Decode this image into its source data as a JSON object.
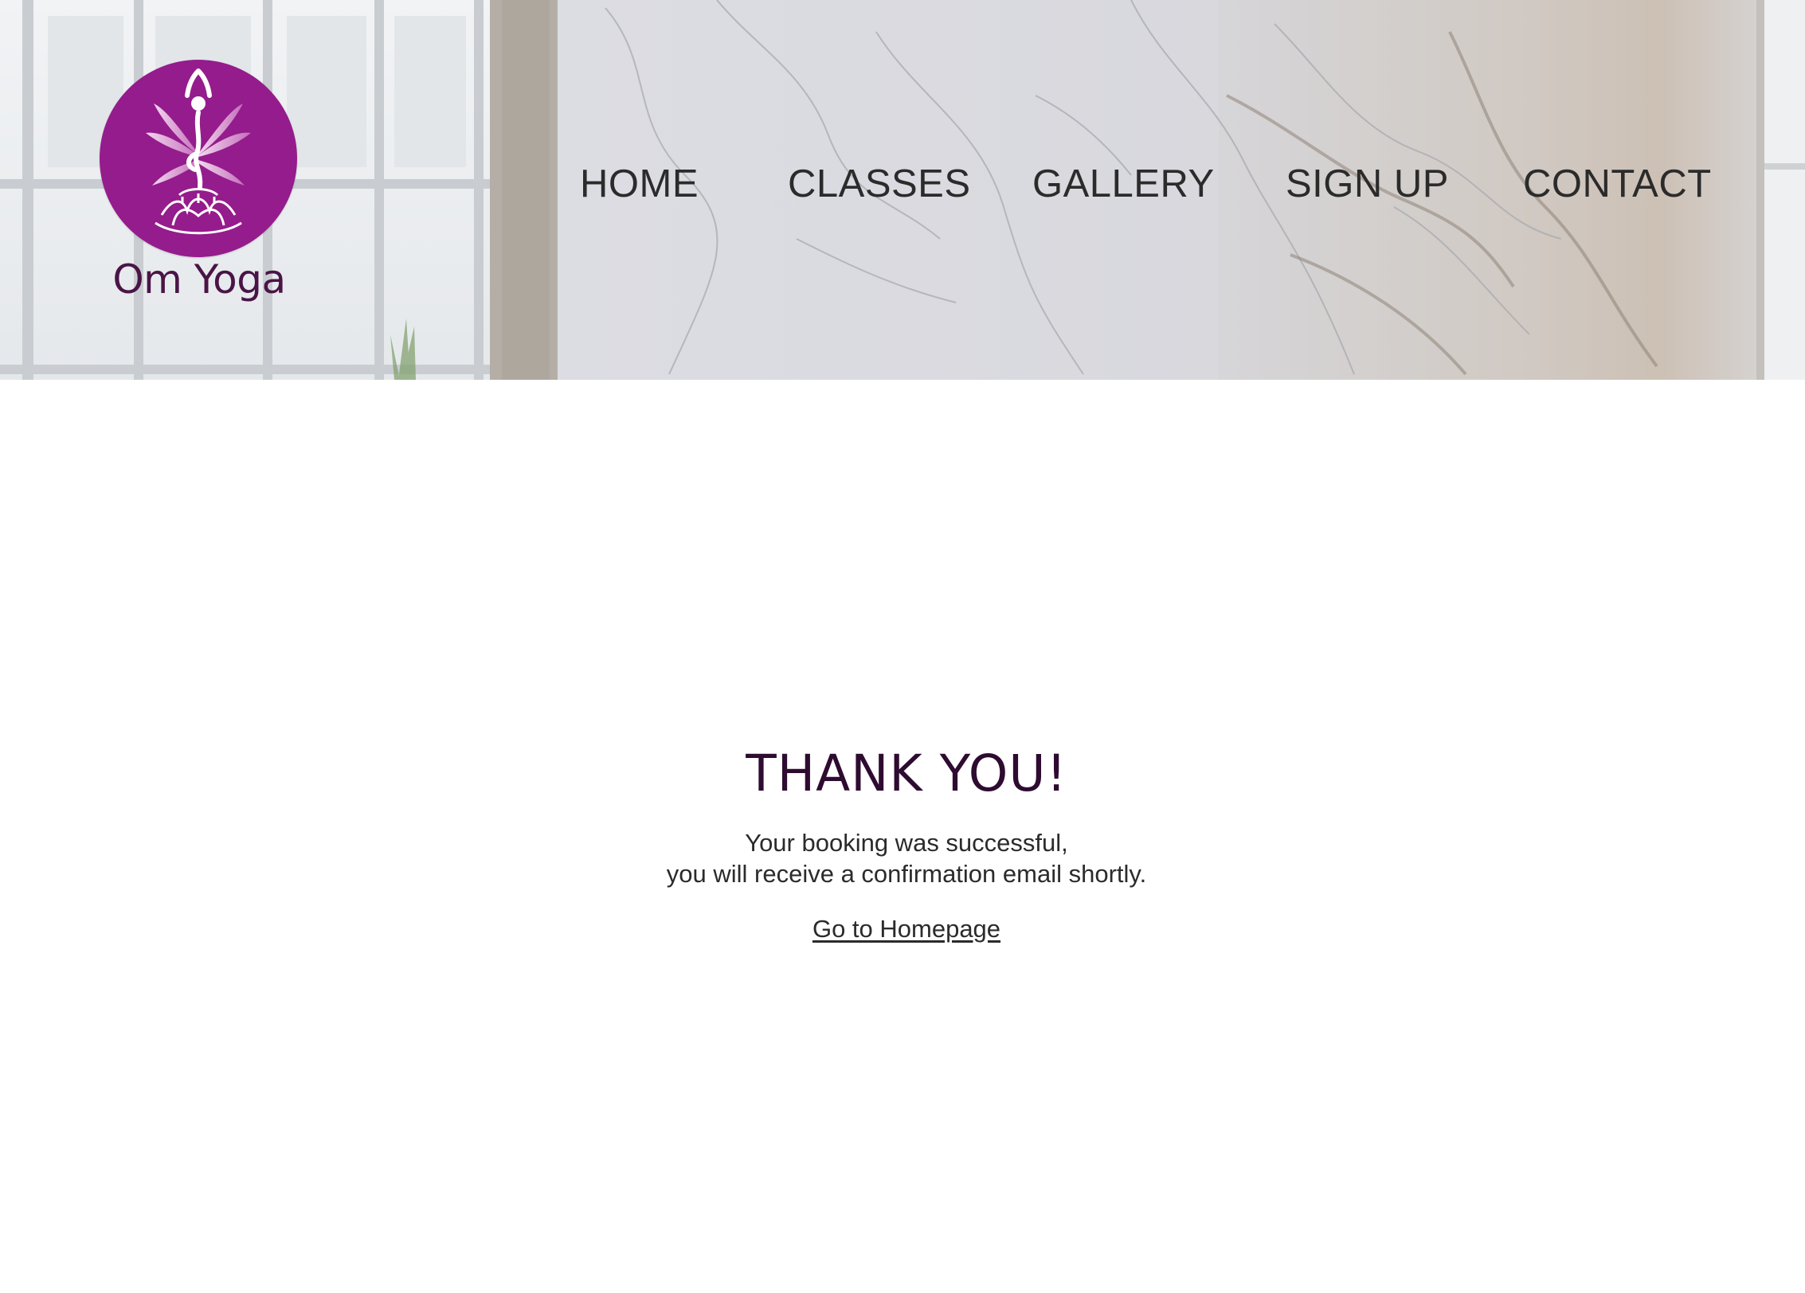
{
  "brand": {
    "name": "Om Yoga",
    "logo_icon": "yoga-tree-pose-lotus-icon",
    "logo_color": "#951c8c",
    "name_color": "#4a1446"
  },
  "nav": {
    "items": [
      {
        "label": "HOME"
      },
      {
        "label": "CLASSES"
      },
      {
        "label": "GALLERY"
      },
      {
        "label": "SIGN UP"
      },
      {
        "label": "CONTACT"
      }
    ]
  },
  "confirmation": {
    "title": "THANK YOU!",
    "line1": "Your booking was successful,",
    "line2": "you will receive a confirmation email shortly.",
    "link_label": "Go to Homepage",
    "title_color": "#2e0b30"
  }
}
